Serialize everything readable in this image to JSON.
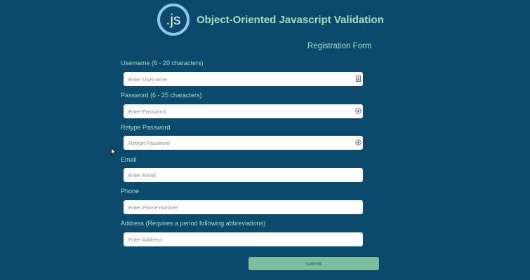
{
  "header": {
    "logo_text": ".js",
    "title": "Object-Oriented Javascript Validation"
  },
  "form": {
    "title": "Registration Form",
    "username": {
      "label": "Username (6 - 20 characters)",
      "placeholder": "Enter Username",
      "icon": "contact-card-icon"
    },
    "password": {
      "label": "Password (6 - 25 characters)",
      "placeholder": "Enter Password",
      "icon": "eye-icon"
    },
    "retype_password": {
      "label": "Retype Password",
      "placeholder": "Retype Password",
      "icon": "eye-icon"
    },
    "email": {
      "label": "Email",
      "placeholder": "Enter Email"
    },
    "phone": {
      "label": "Phone",
      "placeholder": "Enter Phone Number"
    },
    "address": {
      "label": "Address (Requires a period following abbreviations)",
      "placeholder": "Enter Address"
    },
    "submit_label": "submit"
  },
  "colors": {
    "background": "#0b4a6c",
    "accent_text": "#a8dfc1",
    "submit_button": "#7bbd9d",
    "logo_ring": "#8ec9ea"
  }
}
